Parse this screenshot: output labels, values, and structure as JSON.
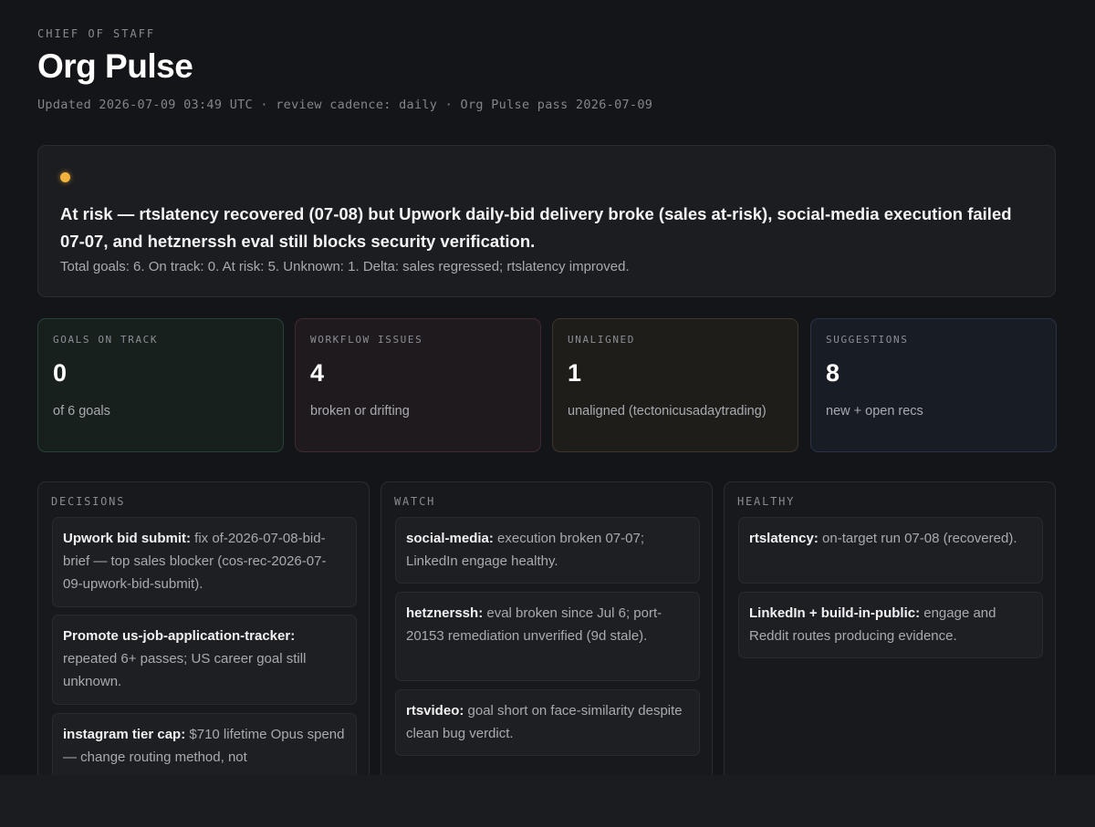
{
  "header": {
    "eyebrow": "CHIEF OF STAFF",
    "title": "Org Pulse",
    "meta": "Updated 2026-07-09 03:49 UTC · review cadence: daily · Org Pulse pass 2026-07-09"
  },
  "status": {
    "color": "#f2b33d",
    "headline": "At risk — rtslatency recovered (07-08) but Upwork daily-bid delivery broke (sales at-risk), social-media execution failed 07-07, and hetznerssh eval still blocks security verification.",
    "summary": "Total goals: 6. On track: 0. At risk: 5. Unknown: 1. Delta: sales regressed; rtslatency improved."
  },
  "kpis": [
    {
      "label": "GOALS ON TRACK",
      "value": "0",
      "sub": "of 6 goals"
    },
    {
      "label": "WORKFLOW ISSUES",
      "value": "4",
      "sub": "broken or drifting"
    },
    {
      "label": "UNALIGNED",
      "value": "1",
      "sub": "unaligned (tectonicusadaytrading)"
    },
    {
      "label": "SUGGESTIONS",
      "value": "8",
      "sub": "new + open recs"
    }
  ],
  "columns": {
    "decisions": {
      "label": "DECISIONS",
      "items": [
        {
          "title": "Upwork bid submit:",
          "text": " fix of-2026-07-08-bid-brief — top sales blocker (cos-rec-2026-07-09-upwork-bid-submit)."
        },
        {
          "title": "Promote us-job-application-tracker:",
          "text": " repeated 6+ passes; US career goal still unknown."
        },
        {
          "title": "instagram tier cap:",
          "text": " $710 lifetime Opus spend — change routing method, not"
        }
      ]
    },
    "watch": {
      "label": "WATCH",
      "items": [
        {
          "title": "social-media:",
          "text": " execution broken 07-07; LinkedIn engage healthy."
        },
        {
          "title": "hetznerssh:",
          "text": " eval broken since Jul 6; port-20153 remediation unverified (9d stale)."
        },
        {
          "title": "rtsvideo:",
          "text": " goal short on face-similarity despite clean bug verdict."
        }
      ]
    },
    "healthy": {
      "label": "HEALTHY",
      "items": [
        {
          "title": "rtslatency:",
          "text": " on-target run 07-08 (recovered)."
        },
        {
          "title": "LinkedIn + build-in-public:",
          "text": " engage and Reddit routes producing evidence."
        }
      ]
    }
  }
}
